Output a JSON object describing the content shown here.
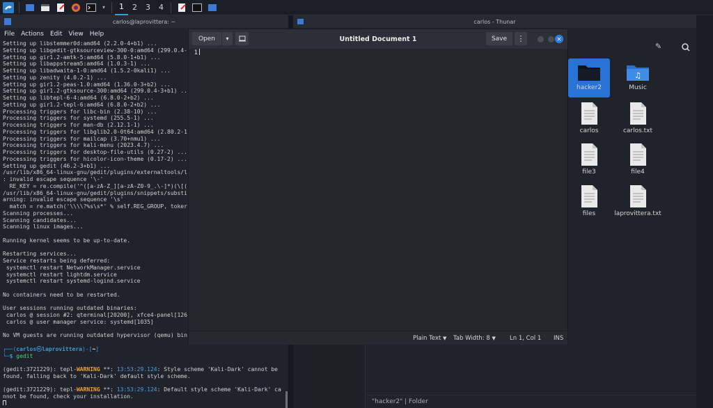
{
  "panel": {
    "workspaces": [
      "1",
      "2",
      "3",
      "4"
    ],
    "right_text": "",
    "colors": {
      "accent": "#3a9bd9"
    }
  },
  "terminal": {
    "title": "carlos@laprovittera: ~",
    "menu": [
      "File",
      "Actions",
      "Edit",
      "View",
      "Help"
    ],
    "lines": [
      {
        "t": "Setting up libstemmer0d:amd64 (2.2.0-4+b1) ...",
        "c": "#d0d0d0"
      },
      {
        "t": "Setting up libgedit-gtksourceview-300-0:amd64 (299.0.4-",
        "c": "#d0d0d0"
      },
      {
        "t": "Setting up gir1.2-amtk-5:amd64 (5.8.0-1+b1) ...",
        "c": "#d0d0d0"
      },
      {
        "t": "Setting up libappstream5:amd64 (1.0.3-1) ...",
        "c": "#d0d0d0"
      },
      {
        "t": "Setting up libadwaita-1-0:amd64 (1.5.2-0kali1) ...",
        "c": "#d0d0d0"
      },
      {
        "t": "Setting up zenity (4.0.2-1) ...",
        "c": "#d0d0d0"
      },
      {
        "t": "Setting up gir1.2-peas-1.0:amd64 (1.36.0-3+b2) ...",
        "c": "#d0d0d0"
      },
      {
        "t": "Setting up gir1.2-gtksource-300:amd64 (299.0.4-3+b1) ...",
        "c": "#d0d0d0"
      },
      {
        "t": "Setting up libtepl-6-4:amd64 (6.8.0-2+b2) ...",
        "c": "#d0d0d0"
      },
      {
        "t": "Setting up gir1.2-tepl-6:amd64 (6.8.0-2+b2) ...",
        "c": "#d0d0d0"
      },
      {
        "t": "Processing triggers for libc-bin (2.38-10) ...",
        "c": "#d0d0d0"
      },
      {
        "t": "Processing triggers for systemd (255.5-1) ...",
        "c": "#d0d0d0"
      },
      {
        "t": "Processing triggers for man-db (2.12.1-1) ...",
        "c": "#d0d0d0"
      },
      {
        "t": "Processing triggers for libglib2.0-0t64:amd64 (2.80.2-1",
        "c": "#d0d0d0"
      },
      {
        "t": "Processing triggers for mailcap (3.70+nmu1) ...",
        "c": "#d0d0d0"
      },
      {
        "t": "Processing triggers for kali-menu (2023.4.7) ...",
        "c": "#d0d0d0"
      },
      {
        "t": "Processing triggers for desktop-file-utils (0.27-2) ...",
        "c": "#d0d0d0"
      },
      {
        "t": "Processing triggers for hicolor-icon-theme (0.17-2) ...",
        "c": "#d0d0d0"
      },
      {
        "t": "Setting up gedit (46.2-3+b1) ...",
        "c": "#d0d0d0"
      },
      {
        "t": "/usr/lib/x86_64-linux-gnu/gedit/plugins/externaltools/l",
        "c": "#d0d0d0"
      },
      {
        "t": ": invalid escape sequence '\\-'",
        "c": "#d0d0d0"
      },
      {
        "t": "  RE_KEY = re.compile('^([a-zA-Z_][a-zA-Z0-9_.\\-]*)(\\[(",
        "c": "#d0d0d0"
      },
      {
        "t": "/usr/lib/x86_64-linux-gnu/gedit/plugins/snippets/substi",
        "c": "#d0d0d0"
      },
      {
        "t": "arning: invalid escape sequence '\\s'",
        "c": "#d0d0d0"
      },
      {
        "t": "  match = re.match('\\\\\\\\?%s\\s*' % self.REG_GROUP, toker",
        "c": "#d0d0d0"
      },
      {
        "t": "Scanning processes...",
        "c": "#d0d0d0"
      },
      {
        "t": "Scanning candidates...",
        "c": "#d0d0d0"
      },
      {
        "t": "Scanning linux images...",
        "c": "#d0d0d0"
      },
      {
        "t": "",
        "c": "#d0d0d0"
      },
      {
        "t": "Running kernel seems to be up-to-date.",
        "c": "#d0d0d0"
      },
      {
        "t": "",
        "c": "#d0d0d0"
      },
      {
        "t": "Restarting services...",
        "c": "#d0d0d0"
      },
      {
        "t": "Service restarts being deferred:",
        "c": "#d0d0d0"
      },
      {
        "t": " systemctl restart NetworkManager.service",
        "c": "#d0d0d0"
      },
      {
        "t": " systemctl restart lightdm.service",
        "c": "#d0d0d0"
      },
      {
        "t": " systemctl restart systemd-logind.service",
        "c": "#d0d0d0"
      },
      {
        "t": "",
        "c": "#d0d0d0"
      },
      {
        "t": "No containers need to be restarted.",
        "c": "#d0d0d0"
      },
      {
        "t": "",
        "c": "#d0d0d0"
      },
      {
        "t": "User sessions running outdated binaries:",
        "c": "#d0d0d0"
      },
      {
        "t": " carlos @ session #2: qterminal[20200], xfce4-panel[126",
        "c": "#d0d0d0"
      },
      {
        "t": " carlos @ user manager service: systemd[1035]",
        "c": "#d0d0d0"
      },
      {
        "t": "",
        "c": "#d0d0d0"
      },
      {
        "t": "No VM guests are running outdated hypervisor (qemu) bin",
        "c": "#d0d0d0"
      },
      {
        "t": "",
        "c": "#d0d0d0"
      }
    ],
    "prompt": {
      "open": "┌──(",
      "user": "carlos",
      "at": "㉿",
      "host": "laprovittera",
      "close": ")-[",
      "dir": "~",
      "end": "]",
      "line2": "└─",
      "dollar": "$",
      "command": "gedit"
    },
    "warnings": [
      {
        "pre": "(gedit:3721229): tepl-",
        "level": "WARNING",
        "mid": " **: ",
        "time": "13:53:29.124",
        "msg1": ": Style scheme 'Kali-Dark' cannot be",
        "msg2": "found, falling back to 'Kali-Dark' default style scheme."
      },
      {
        "pre": "(gedit:3721229): tepl-",
        "level": "WARNING",
        "mid": " **: ",
        "time": "13:53:29.124",
        "msg1": ": Default style scheme 'Kali-Dark' ca",
        "msg2": "nnot be found, check your installation."
      }
    ],
    "colors": {
      "prompt": "#3a9bd9",
      "user": "#ffffff",
      "warning": "#f0a030",
      "time": "#4aa3df",
      "cmd": "#4ad57a"
    }
  },
  "thunar": {
    "title": "carlos - Thunar",
    "files": [
      {
        "name": "hacker2",
        "type": "folder",
        "selected": true
      },
      {
        "name": "Music",
        "type": "music-folder",
        "selected": false
      },
      {
        "name": "carlos",
        "type": "file",
        "selected": false
      },
      {
        "name": "carlos.txt",
        "type": "file",
        "selected": false
      },
      {
        "name": "file3",
        "type": "file",
        "selected": false
      },
      {
        "name": "file4",
        "type": "file",
        "selected": false
      },
      {
        "name": "files",
        "type": "file",
        "selected": false
      },
      {
        "name": "laprovittera.txt",
        "type": "file",
        "selected": false
      }
    ],
    "status": "\"hacker2\" | Folder"
  },
  "gedit": {
    "open_label": "Open",
    "title": "Untitled Document 1",
    "save_label": "Save",
    "line_number": "1",
    "status": {
      "language": "Plain Text",
      "tab_width": "Tab Width: 8",
      "position": "Ln 1, Col 1",
      "mode": "INS"
    }
  }
}
